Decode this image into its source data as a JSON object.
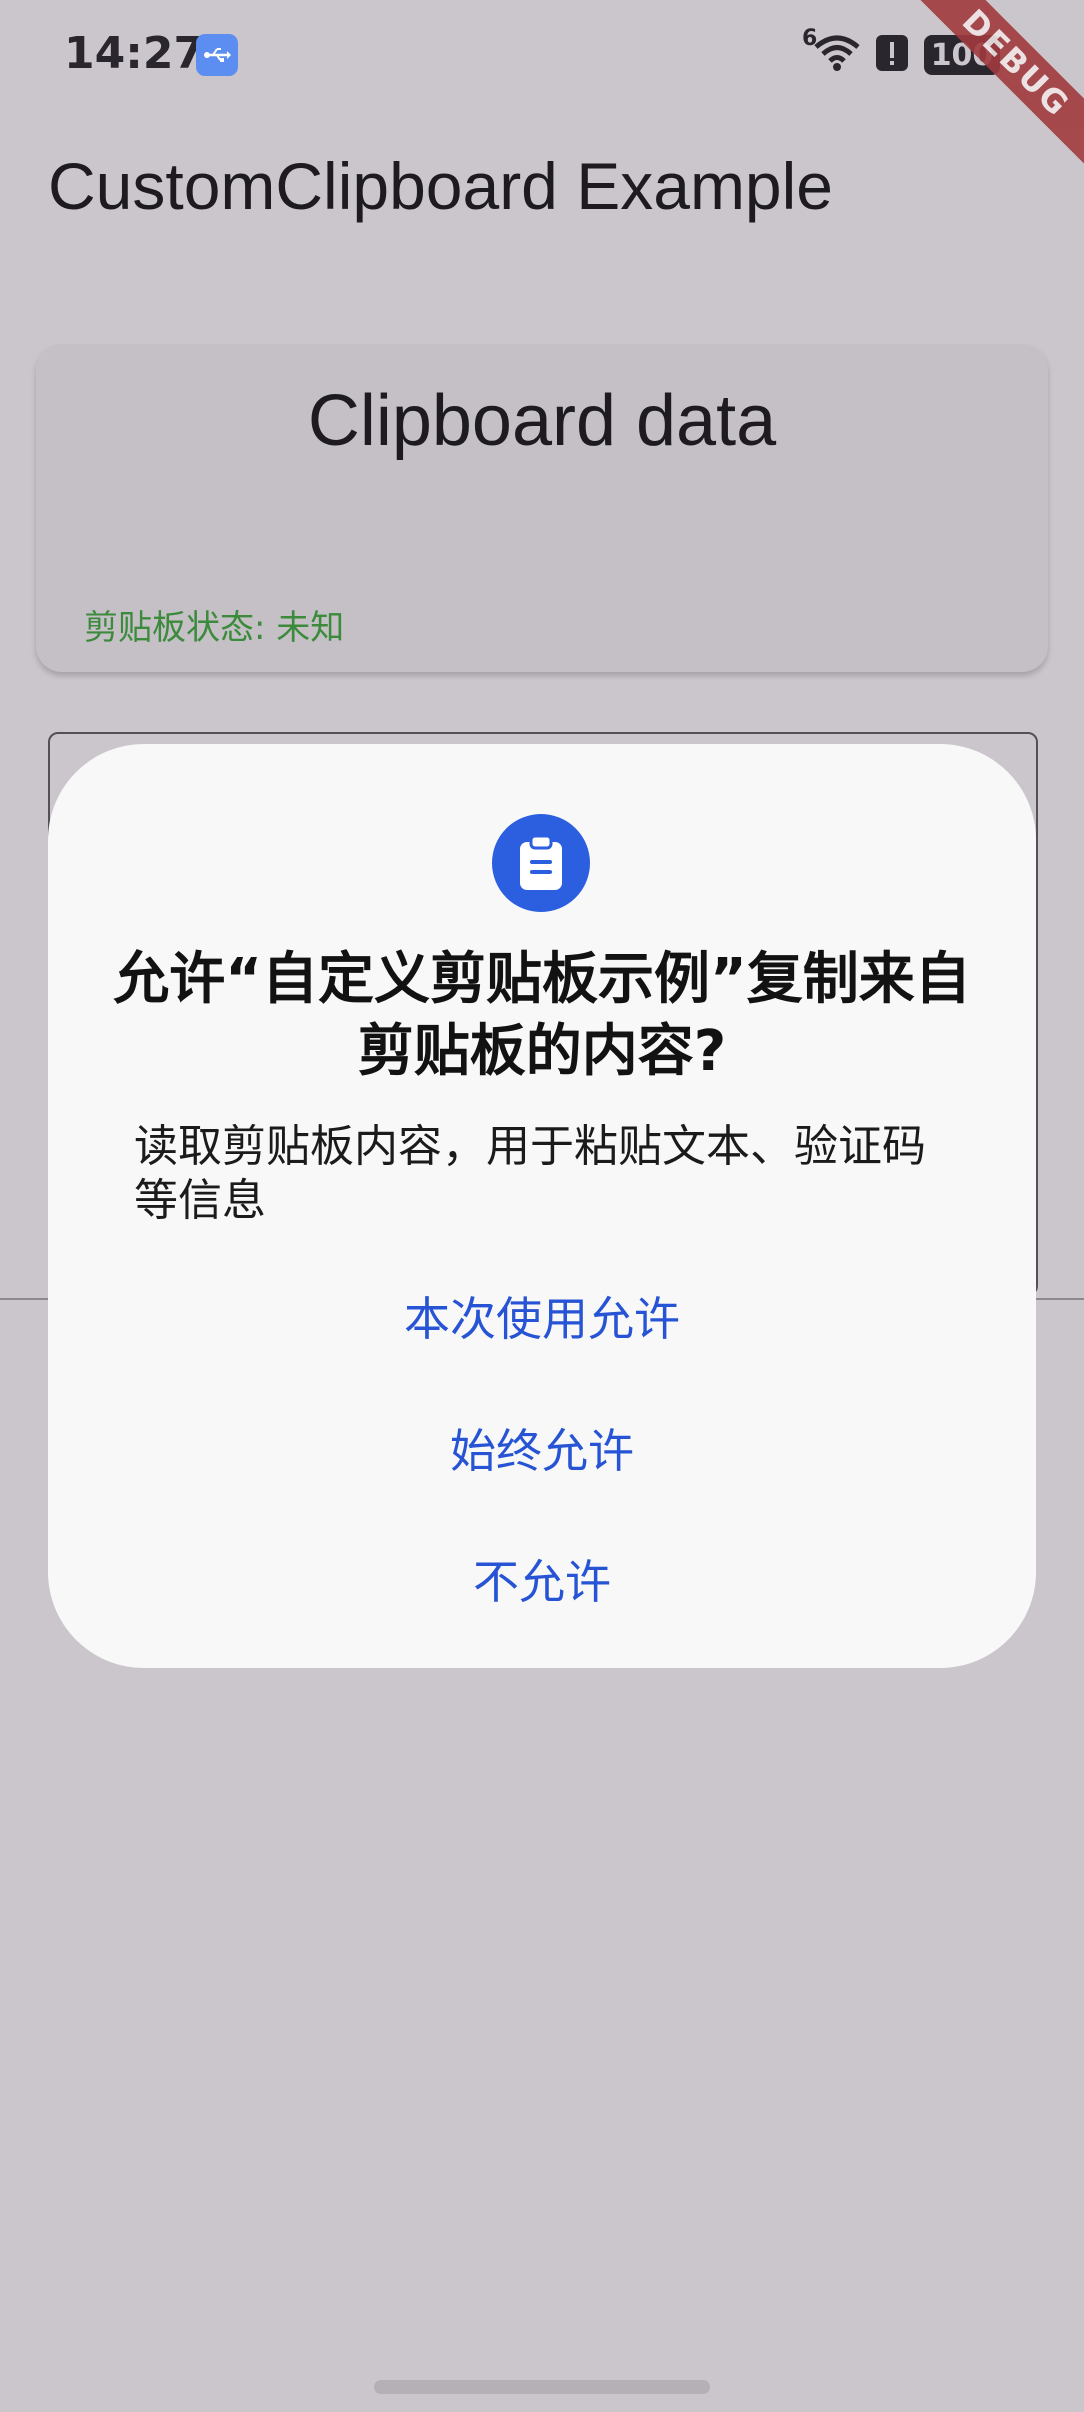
{
  "status_bar": {
    "time": "14:27",
    "network_label": "6",
    "battery_text": "100"
  },
  "debug_banner": "DEBUG",
  "app_bar": {
    "title": "CustomClipboard Example"
  },
  "clipboard_card": {
    "title": "Clipboard data",
    "status": "剪贴板状态: 未知",
    "status_color": "#3c8a3b"
  },
  "permission_dialog": {
    "icon": "clipboard-icon",
    "title": "允许“自定义剪贴板示例”复制来自剪贴板的内容?",
    "description": "读取剪贴板内容，用于粘贴文本、验证码等信息",
    "buttons": {
      "allow_once": "本次使用允许",
      "always_allow": "始终允许",
      "deny": "不允许"
    },
    "accent_color": "#2754d4"
  }
}
